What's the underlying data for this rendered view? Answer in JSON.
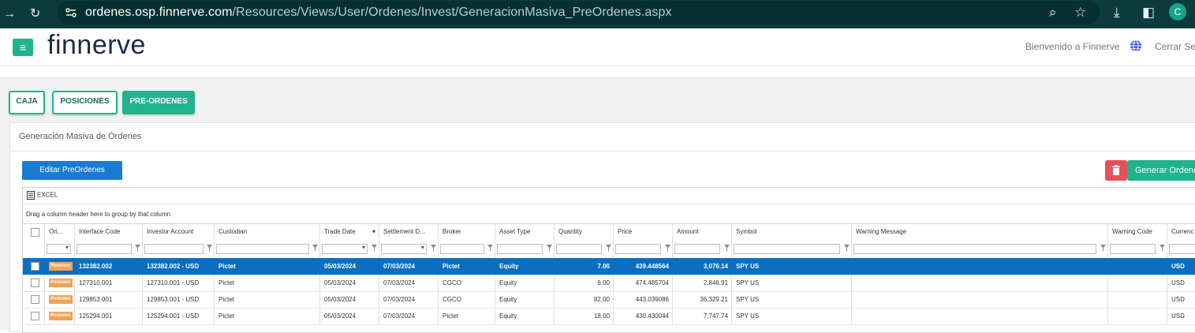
{
  "browser": {
    "url_host": "ordenes.osp.finnerve.com",
    "url_path": "/Resources/Views/User/Ordenes/Invest/GeneracionMasiva_PreOrdenes.aspx",
    "profile_initial": "C"
  },
  "header": {
    "logo": "finnerve",
    "welcome": "Bienvenido a Finnerve",
    "logout": "Cerrar Ses"
  },
  "tabs": [
    {
      "label": "CAJA"
    },
    {
      "label": "POSICIONES"
    },
    {
      "label": "PRE-ORDENES",
      "active": true
    }
  ],
  "panel": {
    "title": "Generación Masiva de Órdenes",
    "edit_button": "Editar PreOrdenes",
    "generate_button": "Generar Ordenes"
  },
  "grid": {
    "excel_label": "EXCEL",
    "group_hint": "Drag a column header here to group by that column",
    "columns": [
      "Ori...",
      "Interface Code",
      "Investor Account",
      "Custodian",
      "Trade Date",
      "Settlement D...",
      "Broker",
      "Asset Type",
      "Quantity",
      "Price",
      "Amount",
      "Symbol",
      "Warning Message",
      "Warning Code",
      "Currenc"
    ],
    "rows": [
      {
        "origin": "Posicion",
        "interface_code": "132382.002",
        "investor_account": "132382.002 - USD",
        "custodian": "Pictet",
        "trade_date": "05/03/2024",
        "settlement_date": "07/03/2024",
        "broker": "Pictet",
        "asset_type": "Equity",
        "quantity": "7.00",
        "price": "439.448564",
        "amount": "3,076.14",
        "symbol": "SPY US",
        "warning_message": "",
        "warning_code": "",
        "currency": "USD"
      },
      {
        "origin": "Posicion",
        "interface_code": "127310.001",
        "investor_account": "127310.001 - USD",
        "custodian": "Pictet",
        "trade_date": "05/03/2024",
        "settlement_date": "07/03/2024",
        "broker": "CGCO",
        "asset_type": "Equity",
        "quantity": "6.00",
        "price": "474.485704",
        "amount": "2,846.91",
        "symbol": "SPY US",
        "warning_message": "",
        "warning_code": "",
        "currency": "USD"
      },
      {
        "origin": "Posicion",
        "interface_code": "129853.001",
        "investor_account": "129853.001 - USD",
        "custodian": "Pictet",
        "trade_date": "05/03/2024",
        "settlement_date": "07/03/2024",
        "broker": "CGCO",
        "asset_type": "Equity",
        "quantity": "82.00",
        "price": "443.039086",
        "amount": "36,329.21",
        "symbol": "SPY US",
        "warning_message": "",
        "warning_code": "",
        "currency": "USD"
      },
      {
        "origin": "Posicion",
        "interface_code": "125294.001",
        "investor_account": "125294.001 - USD",
        "custodian": "Pictet",
        "trade_date": "05/03/2024",
        "settlement_date": "07/03/2024",
        "broker": "Pictet",
        "asset_type": "Equity",
        "quantity": "18.00",
        "price": "430.430044",
        "amount": "7,747.74",
        "symbol": "SPY US",
        "warning_message": "",
        "warning_code": "",
        "currency": "USD"
      }
    ]
  },
  "colors": {
    "brand_green": "#1fb48c",
    "selected_row": "#0a6fc2",
    "edit_blue": "#1a7cd1",
    "delete_red": "#e5505a",
    "origin_badge": "#f0a257"
  }
}
